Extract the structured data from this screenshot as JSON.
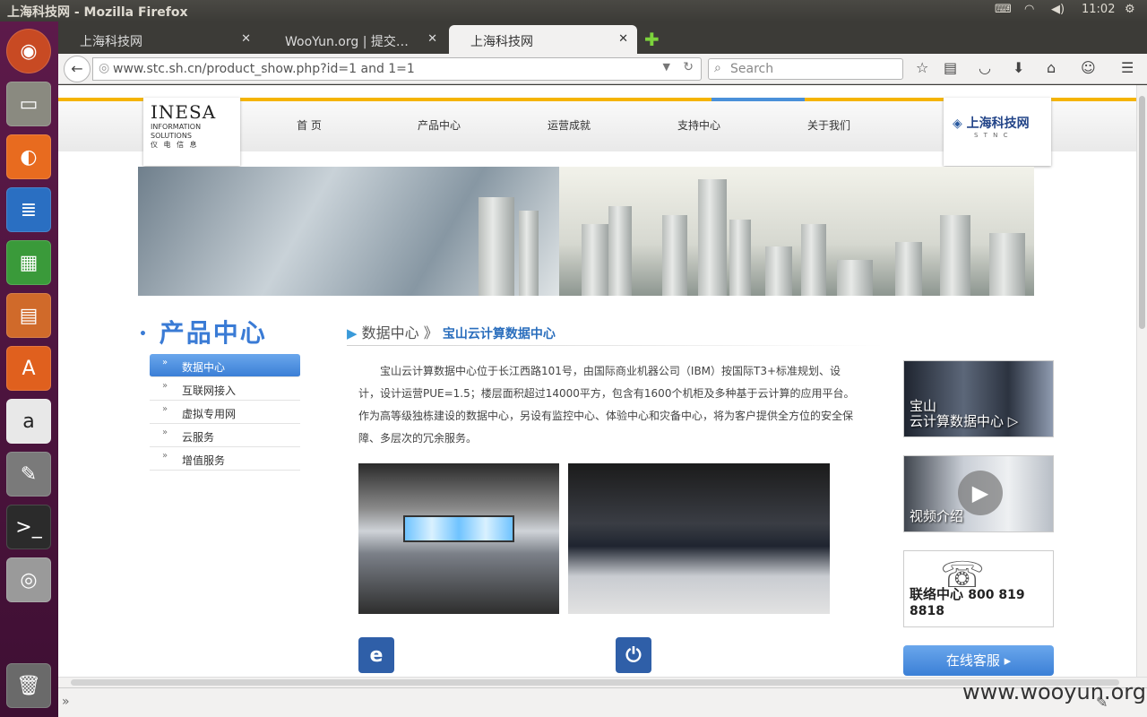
{
  "os": {
    "window_title": "上海科技网 - Mozilla Firefox",
    "clock": "11:02"
  },
  "launcher": {
    "items": [
      "ubuntu-icon",
      "files-icon",
      "firefox-icon",
      "writer-icon",
      "calc-icon",
      "impress-icon",
      "software-center-icon",
      "amazon-icon",
      "system-settings-icon",
      "terminal-icon",
      "camera-icon",
      "trash-icon"
    ]
  },
  "browser": {
    "tabs": [
      {
        "label": "上海科技网",
        "active": false
      },
      {
        "label": "WooYun.org | 提交…",
        "active": false
      },
      {
        "label": "上海科技网",
        "active": true
      }
    ],
    "url": "www.stc.sh.cn/product_show.php?id=1 and 1=1",
    "search_placeholder": "Search"
  },
  "site": {
    "logo_text": "INESA",
    "logo_sub1": "INFORMATION",
    "logo_sub2": "SOLUTIONS",
    "logo_sub3": "仪 电 信 息",
    "nav": [
      "首 页",
      "产品中心",
      "运营成就",
      "支持中心",
      "关于我们"
    ],
    "partner_logo": "上海科技网",
    "partner_sub": "S T N C"
  },
  "sidebar": {
    "title": "产品中心",
    "items": [
      {
        "label": "数据中心",
        "active": true
      },
      {
        "label": "互联网接入",
        "active": false
      },
      {
        "label": "虚拟专用网",
        "active": false
      },
      {
        "label": "云服务",
        "active": false
      },
      {
        "label": "增值服务",
        "active": false
      }
    ]
  },
  "content": {
    "breadcrumb_main": "数据中心",
    "breadcrumb_sep": "》",
    "breadcrumb_sub": "宝山云计算数据中心",
    "description": "宝山云计算数据中心位于长江西路101号，由国际商业机器公司（IBM）按国际T3+标准规划、设计，设计运营PUE=1.5；楼层面积超过14000平方，包含有1600个机柜及多种基于云计算的应用平台。作为高等级独栋建设的数据中心，另设有监控中心、体验中心和灾备中心，将为客户提供全方位的安全保障、多层次的冗余服务。"
  },
  "right": {
    "box1_line1": "宝山",
    "box1_line2": "云计算数据中心 ▷",
    "box2_label": "视频介绍",
    "box3_label": "联络中心",
    "box3_phone": "800 819 8818",
    "service_button": "在线客服 ▸"
  },
  "watermark": "www.wooyun.org"
}
